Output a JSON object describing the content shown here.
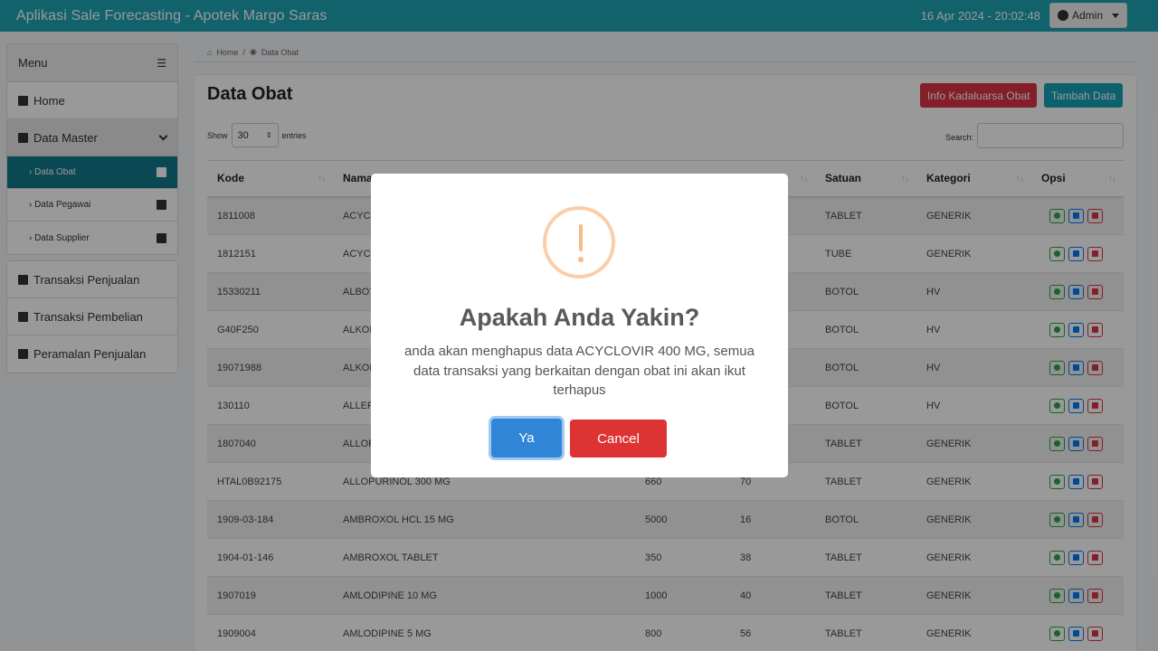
{
  "header": {
    "title": "Aplikasi Sale Forecasting - Apotek Margo Saras",
    "datetime": "16 Apr 2024 -  20:02:48",
    "user": "Admin"
  },
  "sidebar": {
    "menu_label": "Menu",
    "home": "Home",
    "data_master": "Data Master",
    "sub_items": [
      "Data Obat",
      "Data Pegawai",
      "Data Supplier"
    ],
    "transaksi_penjualan": "Transaksi Penjualan",
    "transaksi_pembelian": "Transaksi Pembelian",
    "peramalan": "Peramalan Penjualan"
  },
  "breadcrumb": {
    "home": "Home",
    "current": "Data Obat"
  },
  "main": {
    "title": "Data Obat",
    "btn_expired": "Info Kadaluarsa Obat",
    "btn_add": "Tambah Data",
    "show_label": "Show",
    "show_value": "30",
    "entries_label": "entries",
    "search_label": "Search:"
  },
  "table": {
    "columns": [
      "Kode",
      "Nama",
      "",
      "",
      "Satuan",
      "Kategori",
      "Opsi"
    ],
    "rows": [
      [
        "1811008",
        "ACYCLOVIR 400 MG",
        "",
        "",
        "TABLET",
        "GENERIK"
      ],
      [
        "1812151",
        "ACYCLOVIR CREAM",
        "",
        "",
        "TUBE",
        "GENERIK"
      ],
      [
        "15330211",
        "ALBOTHYL",
        "",
        "",
        "BOTOL",
        "HV"
      ],
      [
        "G40F250",
        "ALKOHOL 70%",
        "",
        "",
        "BOTOL",
        "HV"
      ],
      [
        "19071988",
        "ALKOHOL 96%",
        "",
        "",
        "BOTOL",
        "HV"
      ],
      [
        "130110",
        "ALLERIN",
        "",
        "",
        "BOTOL",
        "HV"
      ],
      [
        "1807040",
        "ALLOPURINOL 100 MG",
        "",
        "",
        "TABLET",
        "GENERIK"
      ],
      [
        "HTAL0B92175",
        "ALLOPURINOL 300 MG",
        "660",
        "70",
        "TABLET",
        "GENERIK"
      ],
      [
        "1909-03-184",
        "AMBROXOL HCL 15 MG",
        "5000",
        "16",
        "BOTOL",
        "GENERIK"
      ],
      [
        "1904-01-146",
        "AMBROXOL TABLET",
        "350",
        "38",
        "TABLET",
        "GENERIK"
      ],
      [
        "1907019",
        "AMLODIPINE 10 MG",
        "1000",
        "40",
        "TABLET",
        "GENERIK"
      ],
      [
        "1909004",
        "AMLODIPINE 5 MG",
        "800",
        "56",
        "TABLET",
        "GENERIK"
      ]
    ]
  },
  "dialog": {
    "title": "Apakah Anda Yakin?",
    "text": "anda akan menghapus data ACYCLOVIR 400 MG, semua data transaksi yang berkaitan dengan obat ini akan ikut terhapus",
    "confirm": "Ya",
    "cancel": "Cancel"
  }
}
